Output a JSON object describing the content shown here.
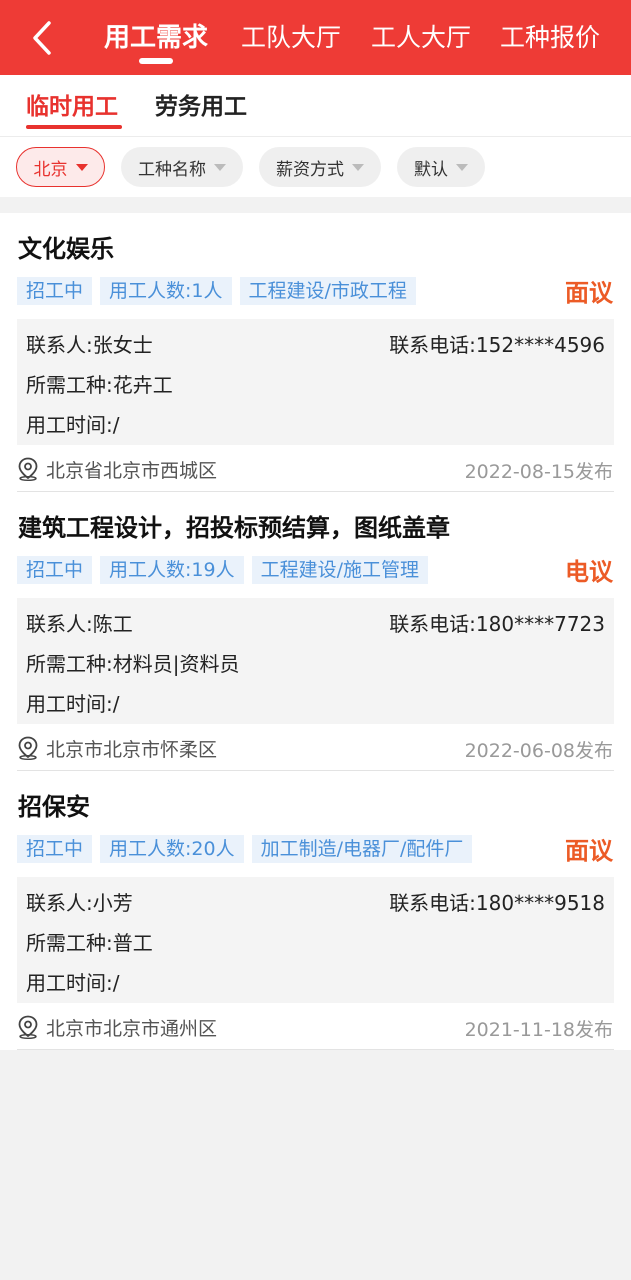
{
  "header": {
    "back_icon": "chevron-left-icon",
    "tabs": [
      {
        "label": "用工需求",
        "active": true
      },
      {
        "label": "工队大厅",
        "active": false
      },
      {
        "label": "工人大厅",
        "active": false
      },
      {
        "label": "工种报价",
        "active": false
      }
    ],
    "accent_color": "#ee3b36"
  },
  "subtabs": [
    {
      "label": "临时用工",
      "active": true
    },
    {
      "label": "劳务用工",
      "active": false
    }
  ],
  "filters": [
    {
      "label": "北京",
      "active": true
    },
    {
      "label": "工种名称",
      "active": false
    },
    {
      "label": "薪资方式",
      "active": false
    },
    {
      "label": "默认",
      "active": false
    }
  ],
  "jobs": [
    {
      "title": "文化娱乐",
      "tags": [
        "招工中",
        "用工人数:1人",
        "工程建设/市政工程"
      ],
      "price": "面议",
      "contact": "联系人:张女士",
      "phone": "联系电话:152****4596",
      "trade": "所需工种:花卉工",
      "time": "用工时间:/",
      "location": "北京省北京市西城区",
      "date": "2022-08-15发布"
    },
    {
      "title": "建筑工程设计，招投标预结算，图纸盖章",
      "tags": [
        "招工中",
        "用工人数:19人",
        "工程建设/施工管理"
      ],
      "price": "电议",
      "contact": "联系人:陈工",
      "phone": "联系电话:180****7723",
      "trade": "所需工种:材料员|资料员",
      "time": "用工时间:/",
      "location": "北京市北京市怀柔区",
      "date": "2022-06-08发布"
    },
    {
      "title": "招保安",
      "tags": [
        "招工中",
        "用工人数:20人",
        "加工制造/电器厂/配件厂"
      ],
      "price": "面议",
      "contact": "联系人:小芳",
      "phone": "联系电话:180****9518",
      "trade": "所需工种:普工",
      "time": "用工时间:/",
      "location": "北京市北京市通州区",
      "date": "2021-11-18发布"
    }
  ]
}
